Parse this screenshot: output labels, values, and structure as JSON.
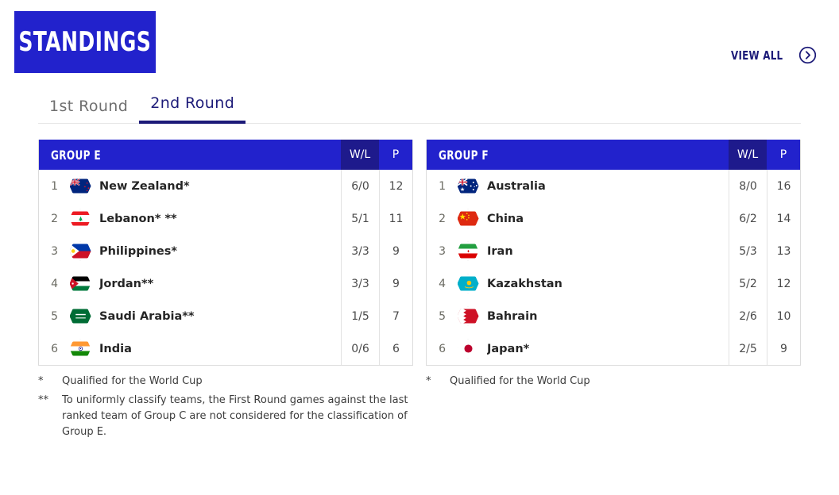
{
  "header": {
    "title": "STANDINGS",
    "view_all_label": "VIEW ALL",
    "arrow_icon": "chevron-right-circle-icon",
    "accent_blue": "#2222cc",
    "navy": "#1c1a78"
  },
  "tabs": [
    {
      "label": "1st Round",
      "active": false
    },
    {
      "label": "2nd Round",
      "active": true
    }
  ],
  "columns": {
    "rank": "",
    "team": "",
    "wl": "W/L",
    "p": "P"
  },
  "groups": [
    {
      "name": "GROUP E",
      "rows": [
        {
          "rank": "1",
          "team": "New Zealand*",
          "flag": "new-zealand-flag-icon",
          "wl": "6/0",
          "p": "12"
        },
        {
          "rank": "2",
          "team": "Lebanon* **",
          "flag": "lebanon-flag-icon",
          "wl": "5/1",
          "p": "11"
        },
        {
          "rank": "3",
          "team": "Philippines*",
          "flag": "philippines-flag-icon",
          "wl": "3/3",
          "p": "9"
        },
        {
          "rank": "4",
          "team": "Jordan**",
          "flag": "jordan-flag-icon",
          "wl": "3/3",
          "p": "9"
        },
        {
          "rank": "5",
          "team": "Saudi Arabia**",
          "flag": "saudi-arabia-flag-icon",
          "wl": "1/5",
          "p": "7"
        },
        {
          "rank": "6",
          "team": "India",
          "flag": "india-flag-icon",
          "wl": "0/6",
          "p": "6"
        }
      ],
      "notes": [
        {
          "mark": "*",
          "text": "Qualified for the World Cup"
        },
        {
          "mark": "**",
          "text": "To uniformly classify teams, the First Round games against the last ranked team of Group C are not considered for the classification of Group E."
        }
      ]
    },
    {
      "name": "GROUP F",
      "rows": [
        {
          "rank": "1",
          "team": "Australia",
          "flag": "australia-flag-icon",
          "wl": "8/0",
          "p": "16"
        },
        {
          "rank": "2",
          "team": "China",
          "flag": "china-flag-icon",
          "wl": "6/2",
          "p": "14"
        },
        {
          "rank": "3",
          "team": "Iran",
          "flag": "iran-flag-icon",
          "wl": "5/3",
          "p": "13"
        },
        {
          "rank": "4",
          "team": "Kazakhstan",
          "flag": "kazakhstan-flag-icon",
          "wl": "5/2",
          "p": "12"
        },
        {
          "rank": "5",
          "team": "Bahrain",
          "flag": "bahrain-flag-icon",
          "wl": "2/6",
          "p": "10"
        },
        {
          "rank": "6",
          "team": "Japan*",
          "flag": "japan-flag-icon",
          "wl": "2/5",
          "p": "9"
        }
      ],
      "notes": [
        {
          "mark": "*",
          "text": "Qualified for the World Cup"
        }
      ]
    }
  ]
}
